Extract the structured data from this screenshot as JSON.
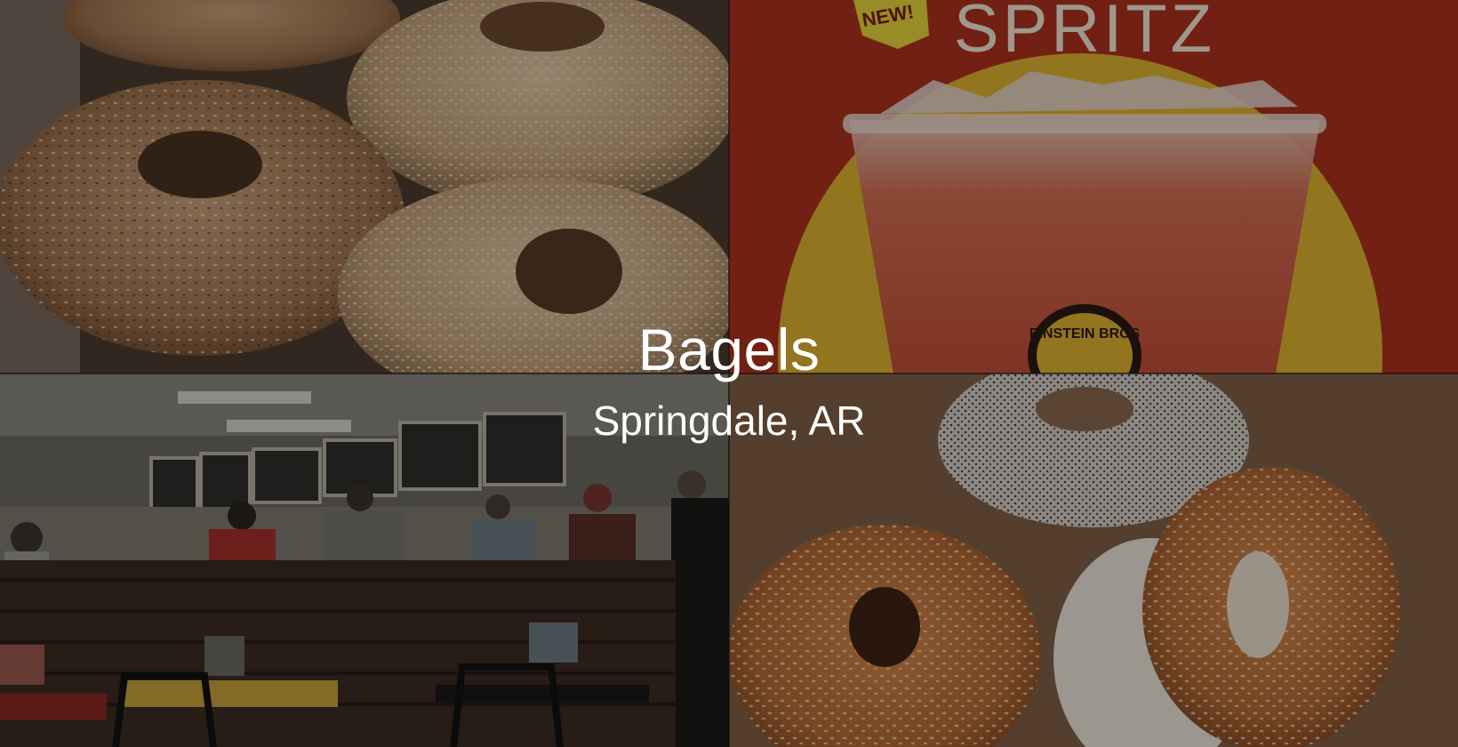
{
  "hero": {
    "title": "Bagels",
    "subtitle": "Springdale, AR",
    "photos": [
      {
        "subject": "seasoned-bagels-photo"
      },
      {
        "subject": "spritz-drink-poster-photo",
        "poster_text": "SPRITZ",
        "badge_text": "NEW!",
        "brand_text": "EINSTEIN BROS"
      },
      {
        "subject": "bagel-shop-counter-photo"
      },
      {
        "subject": "sesame-poppy-bagels-photo"
      }
    ]
  },
  "colors": {
    "overlay": "#000000",
    "text": "#ffffff",
    "poster_red": "#a8301f",
    "poster_yellow": "#e0b431"
  }
}
